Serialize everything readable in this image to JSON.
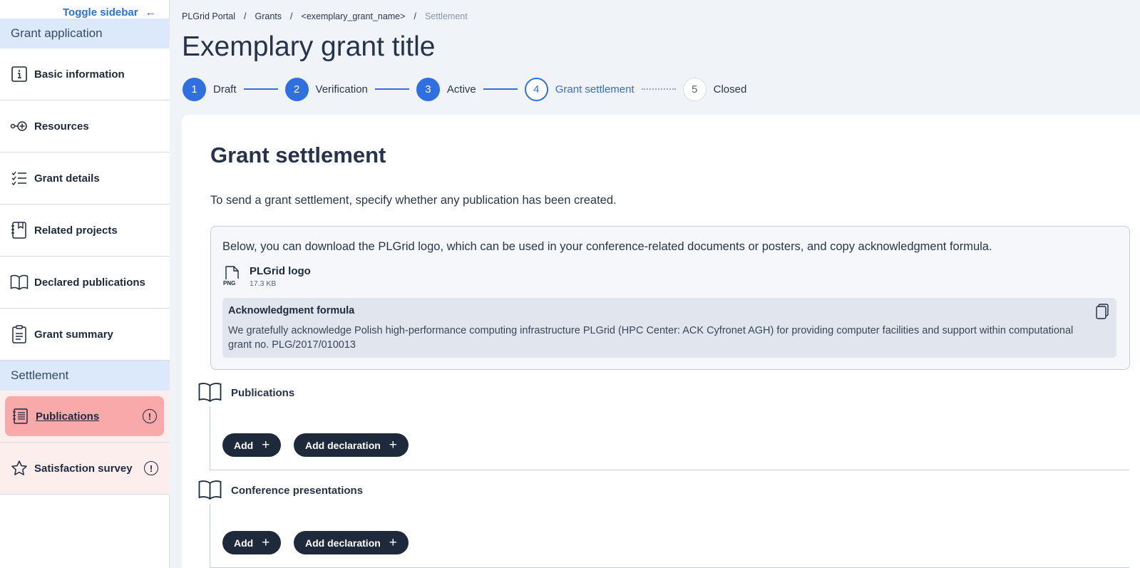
{
  "sidebar": {
    "toggle_label": "Toggle sidebar",
    "section_application": "Grant application",
    "section_settlement": "Settlement",
    "items": [
      {
        "label": "Basic information",
        "icon": "info-icon"
      },
      {
        "label": "Resources",
        "icon": "resources-icon"
      },
      {
        "label": "Grant details",
        "icon": "checklist-icon"
      },
      {
        "label": "Related projects",
        "icon": "bookmark-book-icon"
      },
      {
        "label": "Declared publications",
        "icon": "book-icon"
      },
      {
        "label": "Grant summary",
        "icon": "clipboard-icon"
      }
    ],
    "settlement_items": [
      {
        "label": "Publications",
        "icon": "document-list-icon",
        "active": true,
        "warning": true
      },
      {
        "label": "Satisfaction survey",
        "icon": "star-icon",
        "warning": true
      }
    ],
    "warn_symbol": "!"
  },
  "breadcrumb": [
    "PLGrid Portal",
    "Grants",
    "<exemplary_grant_name>",
    "Settlement"
  ],
  "breadcrumb_sep": "/",
  "page_title": "Exemplary grant title",
  "stepper": [
    {
      "num": "1",
      "label": "Draft",
      "state": "done"
    },
    {
      "num": "2",
      "label": "Verification",
      "state": "done"
    },
    {
      "num": "3",
      "label": "Active",
      "state": "done"
    },
    {
      "num": "4",
      "label": "Grant settlement",
      "state": "current"
    },
    {
      "num": "5",
      "label": "Closed",
      "state": "future"
    }
  ],
  "settlement": {
    "title": "Grant settlement",
    "intro": "To send a grant settlement, specify whether any publication has been created.",
    "info_text": "Below, you can download the PLGrid logo, which can be used in your conference-related documents or posters, and copy acknowledgment formula.",
    "file_name": "PLGrid logo",
    "file_size": "17.3 KB",
    "file_type": "PNG",
    "ack_title": "Acknowledgment formula",
    "ack_text": "We gratefully acknowledge Polish high-performance computing infrastructure PLGrid (HPC Center: ACK Cyfronet AGH) for providing computer facilities and support within computational grant no. PLG/2017/010013"
  },
  "sections": [
    {
      "label": "Publications",
      "add": "Add",
      "add_declaration": "Add declaration"
    },
    {
      "label": "Conference presentations",
      "add": "Add",
      "add_declaration": "Add declaration"
    }
  ],
  "colors": {
    "accent": "#2f6fe0",
    "active_pill": "#f9a9a9",
    "dark_button": "#1e2a3b"
  }
}
